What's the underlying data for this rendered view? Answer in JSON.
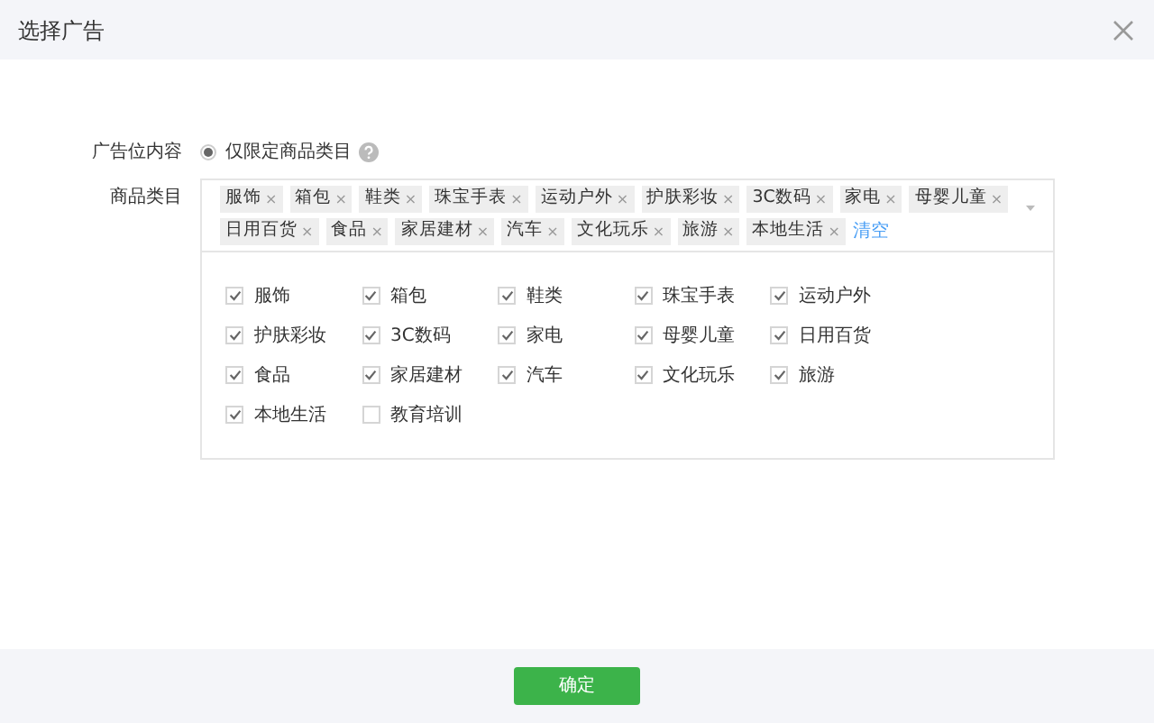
{
  "dialog": {
    "title": "选择广告"
  },
  "content_field": {
    "label": "广告位内容",
    "options": [
      {
        "label": "仅限定商品类目",
        "selected": true
      }
    ]
  },
  "category_field": {
    "label": "商品类目",
    "tags": [
      "服饰",
      "箱包",
      "鞋类",
      "珠宝手表",
      "运动户外",
      "护肤彩妆",
      "3C数码",
      "家电",
      "母婴儿童",
      "日用百货",
      "食品",
      "家居建材",
      "汽车",
      "文化玩乐",
      "旅游",
      "本地生活"
    ],
    "tag_remove": "×",
    "clear_link": "清空",
    "options": [
      {
        "label": "服饰",
        "checked": true
      },
      {
        "label": "箱包",
        "checked": true
      },
      {
        "label": "鞋类",
        "checked": true
      },
      {
        "label": "珠宝手表",
        "checked": true
      },
      {
        "label": "运动户外",
        "checked": true
      },
      {
        "label": "护肤彩妆",
        "checked": true
      },
      {
        "label": "3C数码",
        "checked": true
      },
      {
        "label": "家电",
        "checked": true
      },
      {
        "label": "母婴儿童",
        "checked": true
      },
      {
        "label": "日用百货",
        "checked": true
      },
      {
        "label": "食品",
        "checked": true
      },
      {
        "label": "家居建材",
        "checked": true
      },
      {
        "label": "汽车",
        "checked": true
      },
      {
        "label": "文化玩乐",
        "checked": true
      },
      {
        "label": "旅游",
        "checked": true
      },
      {
        "label": "本地生活",
        "checked": true
      },
      {
        "label": "教育培训",
        "checked": false
      }
    ]
  },
  "footer": {
    "confirm_button": "确定"
  }
}
